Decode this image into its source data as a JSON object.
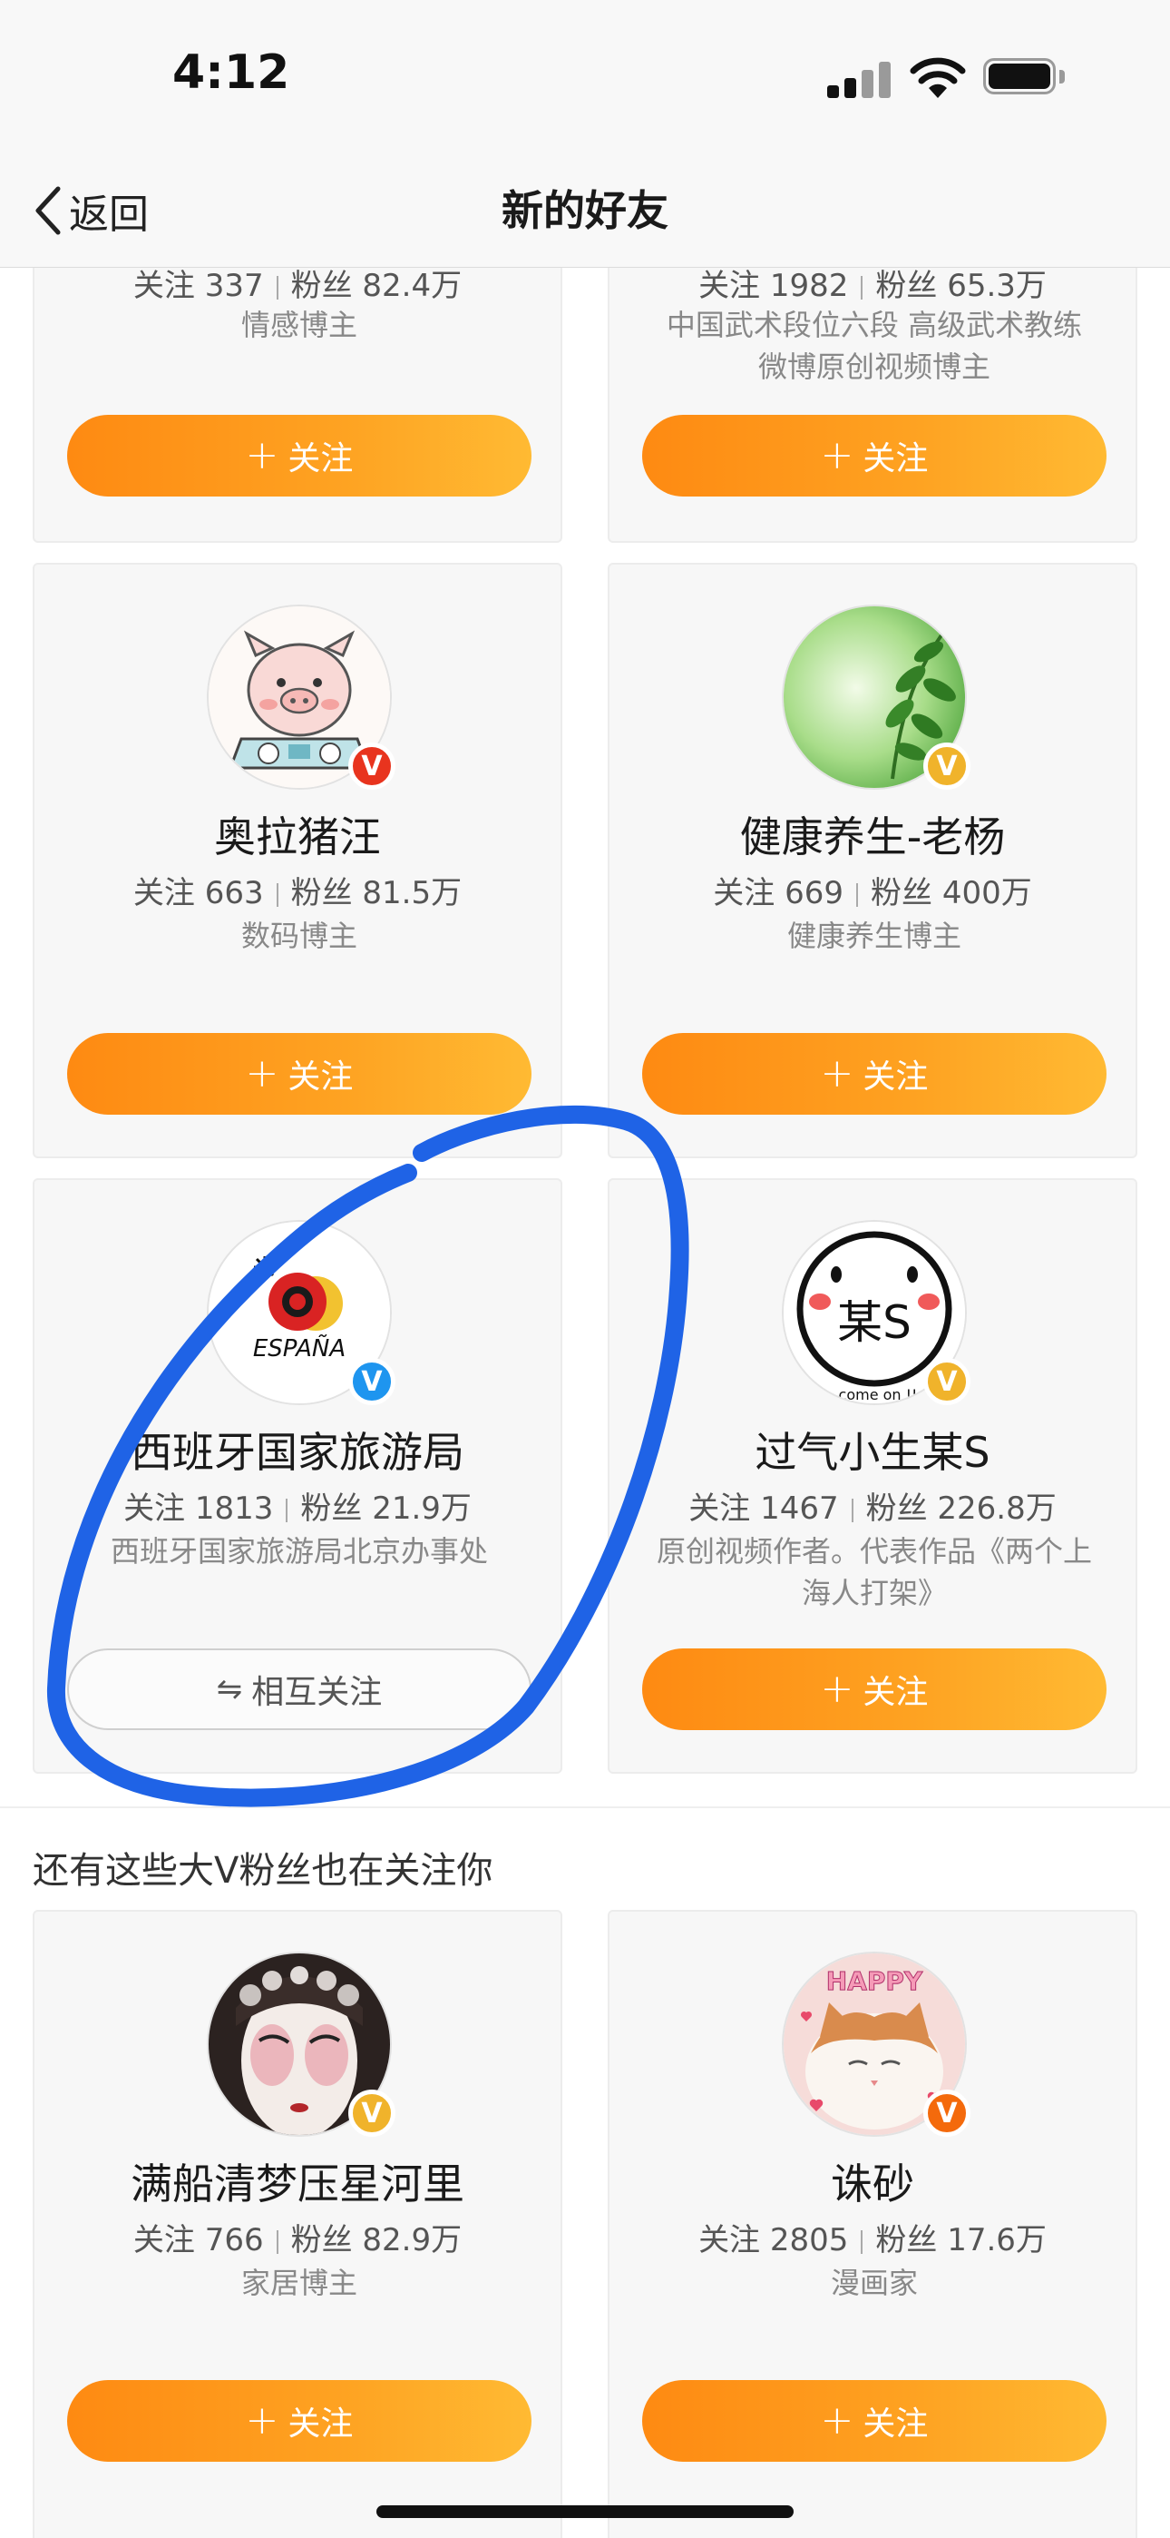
{
  "status_bar": {
    "time": "4:12"
  },
  "nav": {
    "back_label": "返回",
    "title": "新的好友"
  },
  "labels": {
    "follow": "关注",
    "mutual_follow": "相互关注",
    "following_prefix": "关注",
    "fans_prefix": "粉丝"
  },
  "section_1": {
    "cards": [
      {
        "following": "337",
        "fans": "82.4万",
        "desc": "情感博主",
        "button": "+ 关注"
      },
      {
        "following": "1982",
        "fans": "65.3万",
        "desc": "中国武术段位六段 高级武术教练 微博原创视频博主",
        "button": "+ 关注"
      },
      {
        "name": "奥拉猪汪",
        "following": "663",
        "fans": "81.5万",
        "desc": "数码博主",
        "badge": "red",
        "button": "+ 关注"
      },
      {
        "name": "健康养生-老杨",
        "following": "669",
        "fans": "400万",
        "desc": "健康养生博主",
        "badge": "gold",
        "button": "+ 关注"
      },
      {
        "name": "西班牙国家旅游局",
        "following": "1813",
        "fans": "21.9万",
        "desc": "西班牙国家旅游局北京办事处",
        "badge": "blue",
        "button": "⇋ 相互关注",
        "avatar_text": "ESPAÑA"
      },
      {
        "name": "过气小生某S",
        "following": "1467",
        "fans": "226.8万",
        "desc": "原创视频作者。代表作品《两个上海人打架》",
        "badge": "gold",
        "button": "+ 关注",
        "avatar_text": "某S",
        "avatar_caption": "come on !!"
      }
    ]
  },
  "section_2": {
    "header": "还有这些大V粉丝也在关注你",
    "cards": [
      {
        "name": "满船清梦压星河里",
        "following": "766",
        "fans": "82.9万",
        "desc": "家居博主",
        "badge": "gold",
        "button": "+ 关注"
      },
      {
        "name": "诛砂",
        "following": "2805",
        "fans": "17.6万",
        "desc": "漫画家",
        "badge": "orange",
        "button": "+ 关注",
        "avatar_text": "HAPPY"
      }
    ]
  },
  "colors": {
    "follow_gradient_start": "#fe8a12",
    "follow_gradient_end": "#ffba33",
    "annotation_stroke": "#1f63e6",
    "verified_blue": "#1e95ef",
    "verified_gold": "#f0b32b",
    "verified_red": "#e8341e"
  },
  "icons": {
    "back": "chevron-left-icon",
    "verified": "verified-v-icon"
  }
}
